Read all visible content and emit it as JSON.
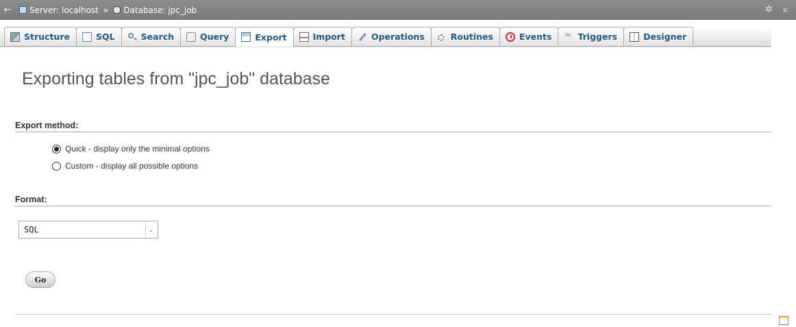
{
  "breadcrumb": {
    "back_glyph": "←",
    "server": "Server: localhost",
    "separator": "»",
    "database": "Database: jpc_job",
    "right_icons": [
      "gear-icon",
      "collapse-icon"
    ]
  },
  "tabs": [
    {
      "label": "Structure",
      "icon": "structure-icon"
    },
    {
      "label": "SQL",
      "icon": "sql-icon"
    },
    {
      "label": "Search",
      "icon": "search-icon"
    },
    {
      "label": "Query",
      "icon": "query-icon"
    },
    {
      "label": "Export",
      "icon": "export-icon",
      "active": true
    },
    {
      "label": "Import",
      "icon": "import-icon"
    },
    {
      "label": "Operations",
      "icon": "wrench-icon"
    },
    {
      "label": "Routines",
      "icon": "routines-icon"
    },
    {
      "label": "Events",
      "icon": "clock-icon"
    },
    {
      "label": "Triggers",
      "icon": "triggers-icon"
    },
    {
      "label": "Designer",
      "icon": "designer-icon"
    }
  ],
  "main": {
    "title": "Exporting tables from \"jpc_job\" database",
    "export_method": {
      "legend": "Export method:",
      "options": [
        {
          "label": "Quick - display only the minimal options",
          "checked": true
        },
        {
          "label": "Custom - display all possible options",
          "checked": false
        }
      ]
    },
    "format": {
      "legend": "Format:",
      "selected": "SQL"
    },
    "go_label": "Go"
  }
}
